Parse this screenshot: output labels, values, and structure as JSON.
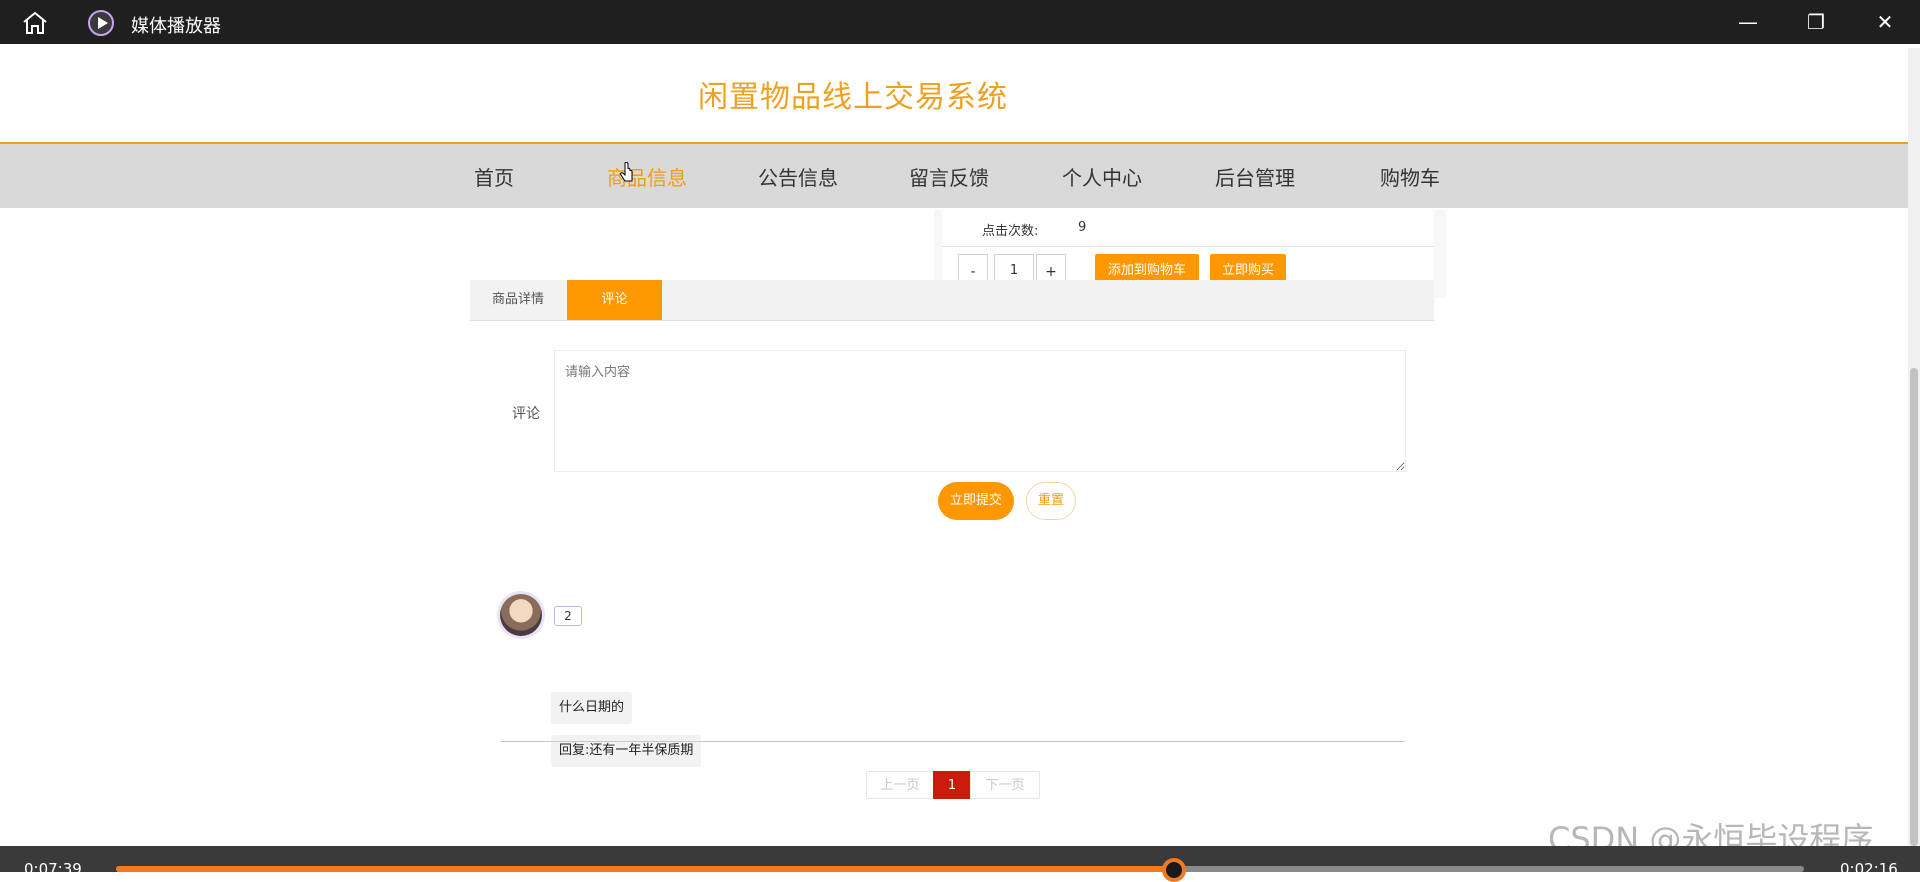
{
  "window": {
    "title": "媒体播放器",
    "controls": {
      "minimize": "—",
      "maximize": "❐",
      "close": "✕"
    }
  },
  "site": {
    "title": "闲置物品线上交易系统",
    "accent_color": "#f0a020"
  },
  "nav": {
    "items": [
      {
        "label": "首页",
        "active": false
      },
      {
        "label": "商品信息",
        "active": true
      },
      {
        "label": "公告信息",
        "active": false
      },
      {
        "label": "留言反馈",
        "active": false
      },
      {
        "label": "个人中心",
        "active": false
      },
      {
        "label": "后台管理",
        "active": false
      },
      {
        "label": "购物车",
        "active": false
      }
    ]
  },
  "product": {
    "clicks_label": "点击次数:",
    "clicks_value": "9",
    "quantity": "1",
    "minus_label": "-",
    "plus_label": "+",
    "add_to_cart_label": "添加到购物车",
    "buy_now_label": "立即购买"
  },
  "tabs": [
    {
      "label": "商品详情",
      "active": false
    },
    {
      "label": "评论",
      "active": true
    }
  ],
  "comment_form": {
    "label": "评论",
    "placeholder": "请输入内容",
    "submit_label": "立即提交",
    "reset_label": "重置"
  },
  "comments": [
    {
      "user": "2",
      "content": "什么日期的",
      "reply": "回复:还有一年半保质期"
    }
  ],
  "pagination": {
    "prev_label": "上一页",
    "current_page": "1",
    "next_label": "下一页"
  },
  "watermark": "CSDN @永恒毕设程序",
  "player": {
    "current_time": "0:07:39",
    "total_time": "0:02:16",
    "progress_fraction": 0.627,
    "accent_color": "#f07a22"
  }
}
